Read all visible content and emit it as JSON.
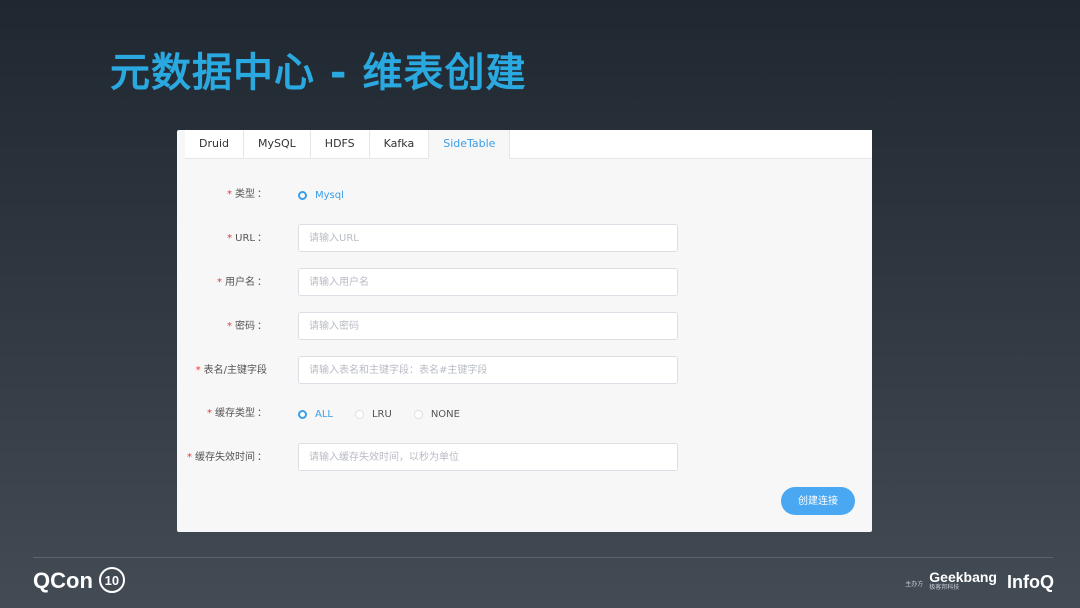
{
  "slide": {
    "title": "元数据中心 - 维表创建"
  },
  "tabs": [
    {
      "label": "Druid",
      "active": false
    },
    {
      "label": "MySQL",
      "active": false
    },
    {
      "label": "HDFS",
      "active": false
    },
    {
      "label": "Kafka",
      "active": false
    },
    {
      "label": "SideTable",
      "active": true
    }
  ],
  "form": {
    "required_mark": "*",
    "colon": "：",
    "type": {
      "label": "类型",
      "options": [
        {
          "label": "Mysql",
          "selected": true
        }
      ]
    },
    "url": {
      "label": "URL",
      "placeholder": "请输入URL",
      "value": ""
    },
    "username": {
      "label": "用户名",
      "placeholder": "请输入用户名",
      "value": ""
    },
    "password": {
      "label": "密码",
      "placeholder": "请输入密码",
      "value": ""
    },
    "table": {
      "label": "表名/主键字段",
      "placeholder": "请输入表名和主键字段：表名#主键字段",
      "value": ""
    },
    "cache_type": {
      "label": "缓存类型",
      "options": [
        {
          "label": "ALL",
          "selected": true
        },
        {
          "label": "LRU",
          "selected": false
        },
        {
          "label": "NONE",
          "selected": false
        }
      ]
    },
    "cache_ttl": {
      "label": "缓存失效时间",
      "placeholder": "请输入缓存失效时间，以秒为单位",
      "value": ""
    },
    "submit_label": "创建连接"
  },
  "footer": {
    "qcon": "QCon",
    "qcon_mark": "10",
    "host_label": "主办方",
    "geekbang": "Geekbang",
    "geekbang_sub": "极客邦科技",
    "infoq": "InfoQ"
  },
  "colors": {
    "accent": "#3a9ee8",
    "title": "#2aa9e0",
    "required": "#e4393c",
    "button": "#4aa8f3"
  }
}
